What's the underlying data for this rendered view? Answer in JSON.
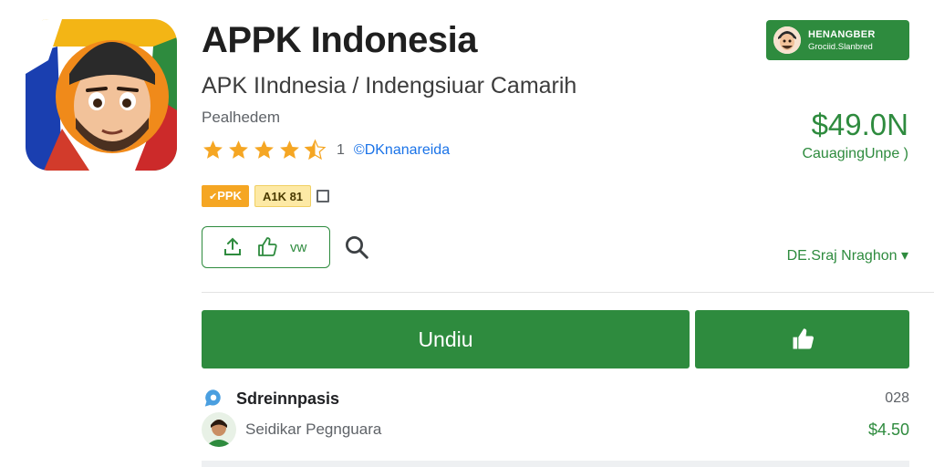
{
  "app": {
    "title": "APPK Indonesia",
    "subtitle": "APK IIndnesia / Indengsiuar Camarih",
    "developer": "Pealhedem",
    "icon": "cartoon-avatar-icon"
  },
  "rating": {
    "stars": 4.5,
    "count": "1",
    "link": "©DKnanareida"
  },
  "badges": {
    "apk": "PPK",
    "age": "A1K 81",
    "info_icon": "info-square-icon"
  },
  "actions": {
    "share_icon": "share-icon",
    "like_icon": "thumbs-up-icon",
    "label": "vw",
    "search_icon": "search-icon"
  },
  "promo": {
    "title": "HENANGBER",
    "subtitle": "Grociid.Slanbred"
  },
  "price": {
    "amount": "$49.0Ν",
    "note": "CauagingUnpe )"
  },
  "language": {
    "label": "DE.Sraj Nraghon",
    "caret": "▾"
  },
  "download": {
    "label": "Undiu",
    "like_icon": "thumbs-up-icon"
  },
  "rows": [
    {
      "label": "Sdreinnpasis",
      "value": "028",
      "icon": "chat-bubble-icon"
    },
    {
      "label": "Seidikar Pegnguara",
      "value": "$4.50",
      "icon": "avatar-icon"
    }
  ],
  "colors": {
    "brand_green": "#2e8b3e",
    "star_orange": "#f5a623",
    "link_blue": "#1a73e8"
  }
}
